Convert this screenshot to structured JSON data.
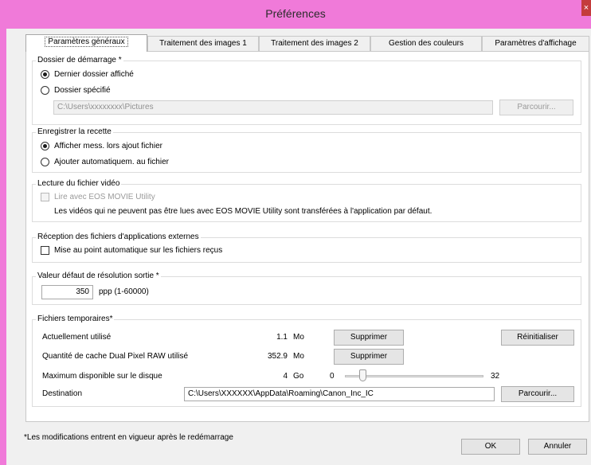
{
  "window": {
    "title": "Préférences",
    "close_glyph": "×"
  },
  "tabs": [
    {
      "label": "Paramètres généraux"
    },
    {
      "label": "Traitement des images 1"
    },
    {
      "label": "Traitement des images 2"
    },
    {
      "label": "Gestion des couleurs"
    },
    {
      "label": "Paramètres d'affichage"
    }
  ],
  "startup_folder": {
    "title": "Dossier de démarrage *",
    "option_last": "Dernier dossier affiché",
    "option_specified": "Dossier spécifié",
    "path": "C:\\Users\\xxxxxxxx\\Pictures",
    "browse_label": "Parcourir...",
    "selected": "last"
  },
  "recipe": {
    "title": "Enregistrer la recette",
    "option_show": "Afficher mess. lors ajout fichier",
    "option_auto": "Ajouter automatiquem. au fichier",
    "selected": "show"
  },
  "video": {
    "title": "Lecture du fichier vidéo",
    "checkbox_label": "Lire avec EOS MOVIE Utility",
    "note": "Les vidéos qui ne peuvent pas être lues avec EOS MOVIE Utility sont transférées à l'application par défaut."
  },
  "external": {
    "title": "Réception des fichiers d'applications externes",
    "checkbox_label": "Mise au point automatique sur les fichiers reçus"
  },
  "resolution": {
    "title": "Valeur défaut de résolution sortie *",
    "value": "350",
    "unit": "ppp (1-60000)"
  },
  "temp": {
    "title": "Fichiers temporaires*",
    "current_label": "Actuellement utilisé",
    "current_value": "1.1",
    "current_unit": "Mo",
    "delete_label": "Supprimer",
    "reset_label": "Réinitialiser",
    "cache_label": "Quantité de cache Dual Pixel RAW utilisé",
    "cache_value": "352.9",
    "cache_unit": "Mo",
    "max_label": "Maximum disponible sur le disque",
    "max_value": "4",
    "max_unit": "Go",
    "slider_min": "0",
    "slider_max": "32",
    "slider_value": 4,
    "destination_label": "Destination",
    "destination_path": "C:\\Users\\XXXXXX\\AppData\\Roaming\\Canon_Inc_IC",
    "browse_label": "Parcourir..."
  },
  "footer": {
    "note": "*Les modifications entrent en vigueur après le redémarrage",
    "ok_label": "OK",
    "cancel_label": "Annuler"
  },
  "colors": {
    "title_bar": "#f07ad9",
    "dialog_bg": "#f0f0f0",
    "panel_bg": "#ffffff"
  }
}
